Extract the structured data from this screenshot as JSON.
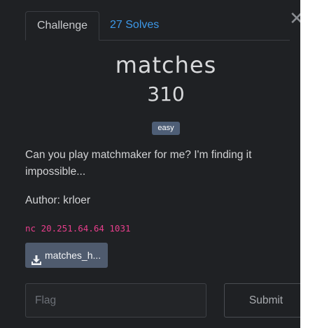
{
  "tabs": [
    {
      "label": "Challenge"
    },
    {
      "label": "27 Solves"
    }
  ],
  "challenge": {
    "name": "matches",
    "points": "310",
    "difficulty": "easy",
    "description": "Can you play matchmaker for me? I'm finding it impossible...",
    "author": "Author: krloer",
    "connection": "nc 20.251.64.64 1031",
    "file_label": "matches_h..."
  },
  "flag": {
    "placeholder": "Flag",
    "submit_label": "Submit"
  },
  "icons": {
    "close": "close-icon",
    "download": "download-icon"
  },
  "colors": {
    "background": "#1f2124",
    "accent_link": "#3d98e8",
    "badge": "#4e5e76",
    "code": "#e83e8c",
    "file_button": "#4f5b6e"
  }
}
